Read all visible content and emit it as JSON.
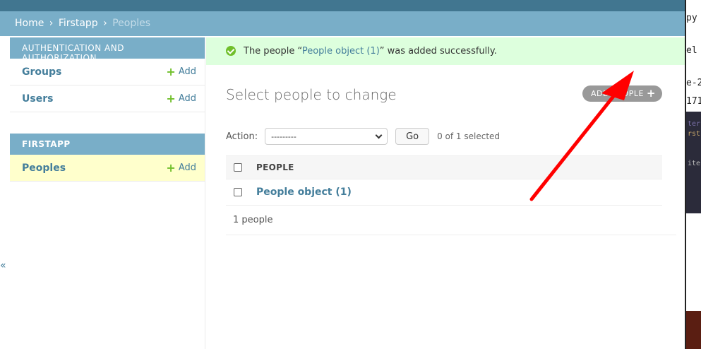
{
  "breadcrumbs": {
    "home": "Home",
    "app": "Firstapp",
    "current": "Peoples",
    "separator": "›"
  },
  "sidebar": {
    "modules": [
      {
        "caption": "AUTHENTICATION AND AUTHORIZATION",
        "items": [
          {
            "label": "Groups",
            "add": "Add"
          },
          {
            "label": "Users",
            "add": "Add"
          }
        ]
      },
      {
        "caption": "FIRSTAPP",
        "items": [
          {
            "label": "Peoples",
            "add": "Add"
          }
        ]
      }
    ],
    "collapse": "«"
  },
  "message": {
    "prefix": "The people “",
    "link": "People object (1)",
    "suffix": "” was added successfully."
  },
  "page_title": "Select people to change",
  "add_button": "ADD PEOPLE",
  "actions": {
    "label": "Action:",
    "selected_option": "---------",
    "go": "Go",
    "count": "0 of 1 selected"
  },
  "table": {
    "header": "PEOPLE",
    "rows": [
      "People object (1)"
    ]
  },
  "paginator": "1 people",
  "right_panel": {
    "lines": [
      "py",
      "el",
      "e-2",
      "171"
    ],
    "dark_lines": [
      "ter",
      "rst",
      "ite"
    ]
  },
  "colors": {
    "header": "#417690",
    "breadcrumbs": "#79aec8",
    "success": "#dddfdd",
    "link": "#447e9b",
    "add_icon": "#70bf2b",
    "arrow": "#ff0000"
  }
}
